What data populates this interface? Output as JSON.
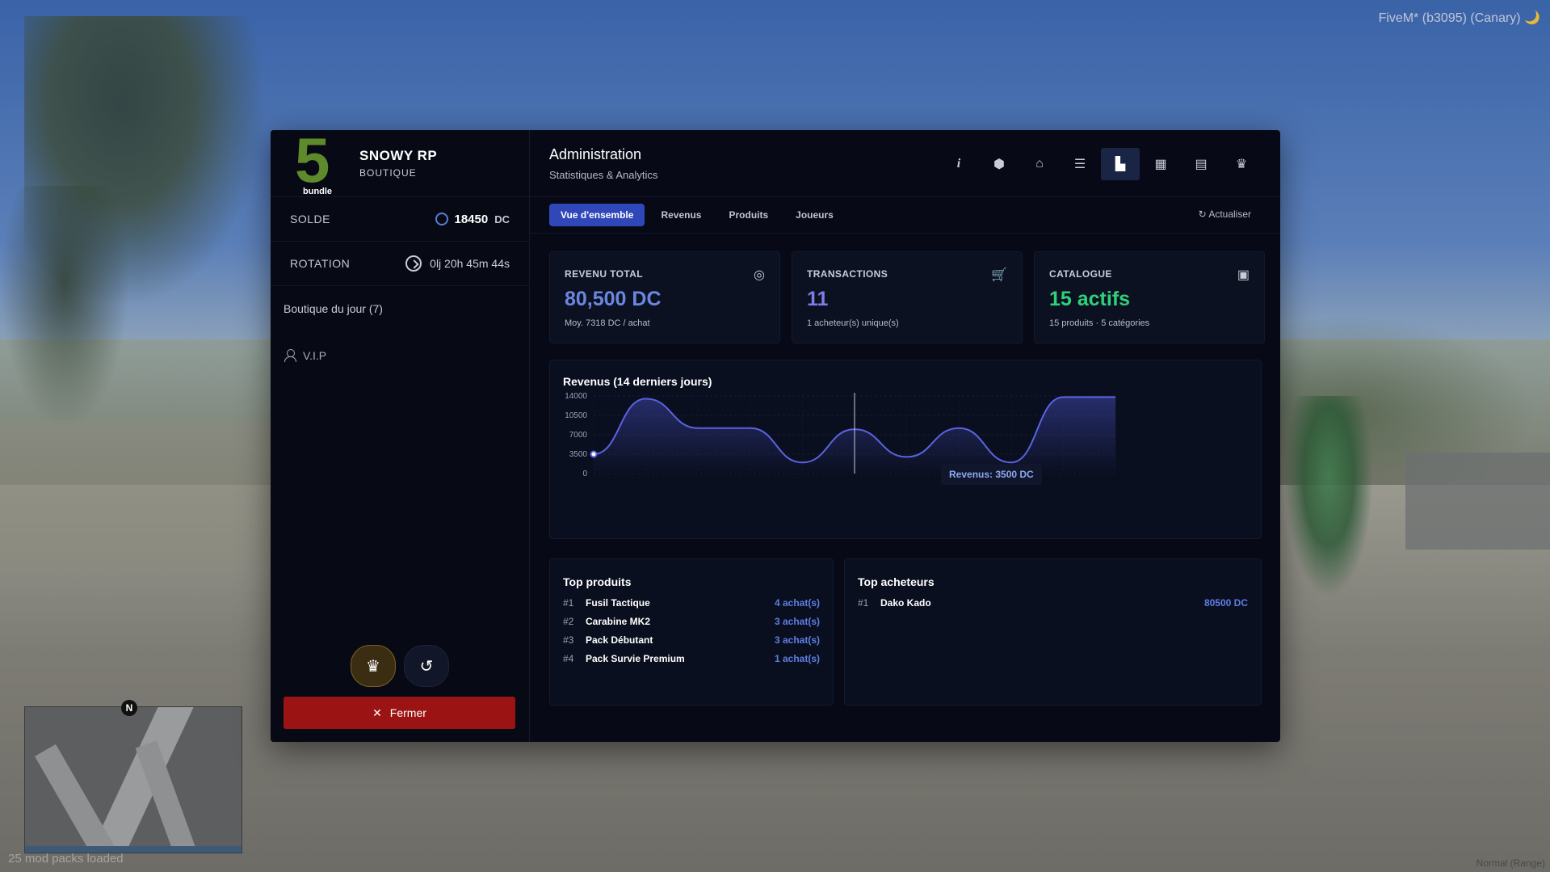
{
  "overlay": {
    "fivem": "FiveM* (b3095) (Canary) 🌙",
    "mods_loaded": "25 mod packs loaded",
    "corner_text": "Normal (Range)",
    "north": "N"
  },
  "brand": {
    "logo_number": "5",
    "logo_caption": "bundle",
    "name": "SNOWY RP",
    "subtitle": "BOUTIQUE"
  },
  "sidebar": {
    "balance_label": "SOLDE",
    "balance_value": "18450",
    "balance_unit": "DC",
    "rotation_label": "ROTATION",
    "rotation_value": "0lj 20h 45m 44s",
    "shop_of_day": "Boutique du jour (7)",
    "vip": "V.I.P",
    "close_label": "Fermer",
    "close_icon": "✕"
  },
  "header": {
    "title": "Administration",
    "subtitle": "Statistiques & Analytics",
    "tools": [
      {
        "icon": "info-icon",
        "glyph": "i"
      },
      {
        "icon": "box-icon",
        "glyph": "⬢"
      },
      {
        "icon": "bank-icon",
        "glyph": "⌂"
      },
      {
        "icon": "list-icon",
        "glyph": "☰"
      },
      {
        "icon": "chart-icon",
        "glyph": "▙",
        "active": true
      },
      {
        "icon": "calendar-icon",
        "glyph": "▦"
      },
      {
        "icon": "document-icon",
        "glyph": "▤"
      },
      {
        "icon": "crown-icon",
        "glyph": "♛"
      }
    ]
  },
  "tabs": [
    "Vue d'ensemble",
    "Revenus",
    "Produits",
    "Joueurs"
  ],
  "active_tab": "Vue d'ensemble",
  "refresh_label": "Actualiser",
  "cards": [
    {
      "label": "REVENU TOTAL",
      "value": "80,500 DC",
      "sub": "Moy. 7318 DC / achat",
      "color": "#6b86e0",
      "icon": "coins-icon"
    },
    {
      "label": "TRANSACTIONS",
      "value": "11",
      "sub": "1 acheteur(s) unique(s)",
      "color": "#7d7de8",
      "icon": "cart-icon"
    },
    {
      "label": "CATALOGUE",
      "value": "15 actifs",
      "sub": "15 produits · 5 catégories",
      "color": "#2fd07a",
      "icon": "calendar-icon"
    }
  ],
  "chart_data": {
    "type": "area",
    "title": "Revenus (14 derniers jours)",
    "y_ticks": [
      "14000",
      "10500",
      "7000",
      "3500",
      "0"
    ],
    "ylim": [
      0,
      14000
    ],
    "values": [
      3500,
      13500,
      8200,
      8200,
      2000,
      8000,
      3000,
      8200,
      2000,
      13800,
      13800
    ],
    "tooltip": "Revenus: 3500 DC",
    "line_color": "#5a63e0",
    "grid": true
  },
  "top_products": {
    "title": "Top produits",
    "items": [
      {
        "rank": "#1",
        "name": "Fusil Tactique",
        "value": "4 achat(s)"
      },
      {
        "rank": "#2",
        "name": "Carabine MK2",
        "value": "3 achat(s)"
      },
      {
        "rank": "#3",
        "name": "Pack Débutant",
        "value": "3 achat(s)"
      },
      {
        "rank": "#4",
        "name": "Pack Survie Premium",
        "value": "1 achat(s)"
      }
    ]
  },
  "top_buyers": {
    "title": "Top acheteurs",
    "items": [
      {
        "rank": "#1",
        "name": "Dako Kado",
        "value": "80500 DC"
      }
    ]
  }
}
